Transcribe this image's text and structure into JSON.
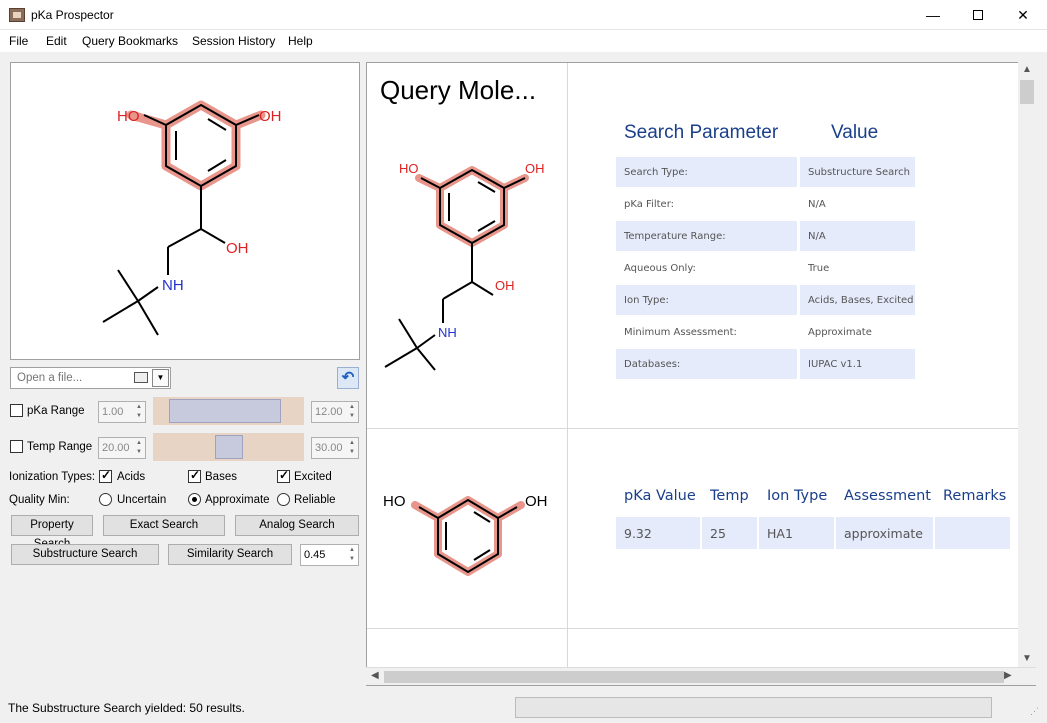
{
  "window": {
    "title": "pKa Prospector",
    "controls": {
      "minimize": "—",
      "close": "✕"
    }
  },
  "menu": [
    "File",
    "Edit",
    "Query Bookmarks",
    "Session History",
    "Help"
  ],
  "molecule": {
    "atoms": {
      "ho": "HO",
      "oh": "OH",
      "oh_side": "OH",
      "nh": "NH"
    },
    "highlight_color": "#e8958b",
    "n_color": "#2233cc",
    "o_color": "#dd2222"
  },
  "file": {
    "placeholder": "Open a file..."
  },
  "filters": {
    "pka_range": {
      "label": "pKa Range",
      "min": "1.00",
      "max": "12.00",
      "checked": false
    },
    "temp_range": {
      "label": "Temp Range",
      "min": "20.00",
      "max": "30.00",
      "checked": false
    },
    "ionization_label": "Ionization Types:",
    "ionization": [
      {
        "label": "Acids",
        "checked": true
      },
      {
        "label": "Bases",
        "checked": true
      },
      {
        "label": "Excited",
        "checked": true
      }
    ],
    "quality_label": "Quality Min:",
    "quality": [
      {
        "label": "Uncertain",
        "selected": false
      },
      {
        "label": "Approximate",
        "selected": true
      },
      {
        "label": "Reliable",
        "selected": false
      }
    ]
  },
  "buttons": {
    "property": "Property Search",
    "exact": "Exact Search",
    "analog": "Analog Search",
    "substructure": "Substructure Search",
    "similarity": "Similarity Search",
    "similarity_value": "0.45"
  },
  "results": {
    "query_title": "Query Mole...",
    "param_header": "Search Parameter",
    "value_header": "Value",
    "params": [
      {
        "name": "Search Type:",
        "value": "Substructure Search"
      },
      {
        "name": "pKa Filter:",
        "value": "N/A"
      },
      {
        "name": "Temperature Range:",
        "value": "N/A"
      },
      {
        "name": "Aqueous Only:",
        "value": "True"
      },
      {
        "name": "Ion Type:",
        "value": "Acids, Bases, Excited"
      },
      {
        "name": "Minimum Assessment:",
        "value": "Approximate"
      },
      {
        "name": "Databases:",
        "value": "IUPAC v1.1"
      }
    ],
    "table_headers": [
      "pKa Value",
      "Temp",
      "Ion Type",
      "Assessment",
      "Remarks"
    ],
    "rows": [
      {
        "pka": "9.32",
        "temp": "25",
        "ion": "HA1",
        "assessment": "approximate",
        "remarks": ""
      }
    ],
    "result_mol": {
      "ho": "HO",
      "oh": "OH"
    }
  },
  "status": {
    "message": "The Substructure Search yielded: 50 results."
  }
}
